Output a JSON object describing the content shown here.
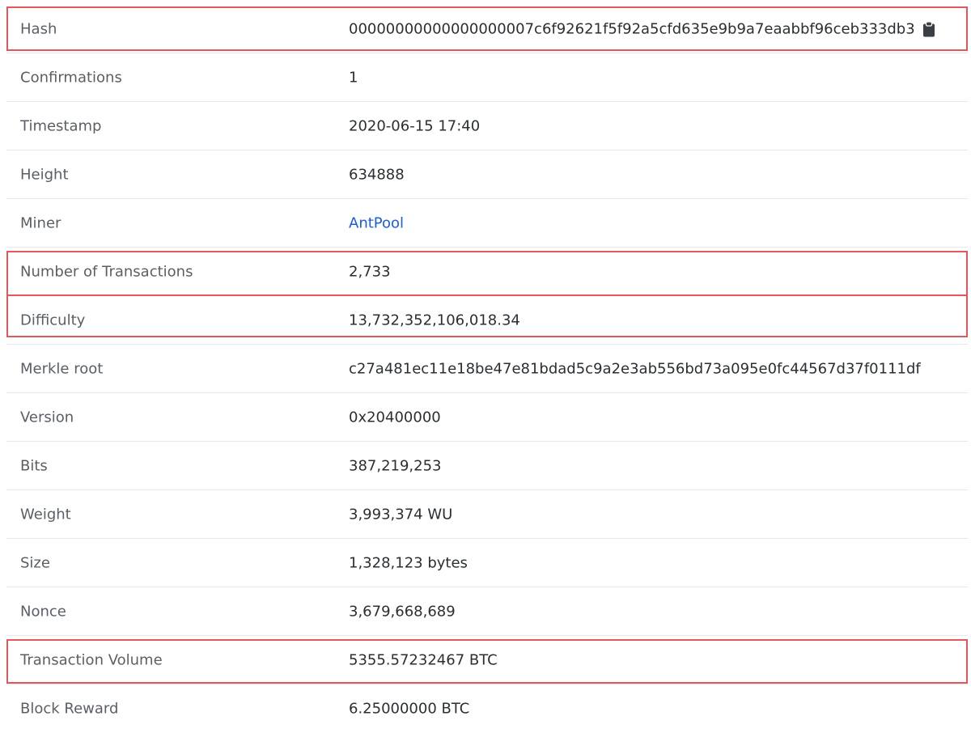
{
  "block": {
    "rows": [
      {
        "label": "Hash",
        "value": "00000000000000000007c6f92621f5f92a5cfd635e9b9a7eaabbf96ceb333db3"
      },
      {
        "label": "Confirmations",
        "value": "1"
      },
      {
        "label": "Timestamp",
        "value": "2020-06-15 17:40"
      },
      {
        "label": "Height",
        "value": "634888"
      },
      {
        "label": "Miner",
        "value": "AntPool"
      },
      {
        "label": "Number of Transactions",
        "value": "2,733"
      },
      {
        "label": "Difficulty",
        "value": "13,732,352,106,018.34"
      },
      {
        "label": "Merkle root",
        "value": "c27a481ec11e18be47e81bdad5c9a2e3ab556bd73a095e0fc44567d37f0111df"
      },
      {
        "label": "Version",
        "value": "0x20400000"
      },
      {
        "label": "Bits",
        "value": "387,219,253"
      },
      {
        "label": "Weight",
        "value": "3,993,374 WU"
      },
      {
        "label": "Size",
        "value": "1,328,123 bytes"
      },
      {
        "label": "Nonce",
        "value": "3,679,668,689"
      },
      {
        "label": "Transaction Volume",
        "value": "5355.57232467 BTC"
      },
      {
        "label": "Block Reward",
        "value": "6.25000000 BTC"
      }
    ]
  },
  "icons": {
    "copy": "clipboard-icon"
  },
  "colors": {
    "highlight": "#e0585c",
    "link": "#1a5fd6",
    "label": "#5a5f66",
    "value": "#2b2f33",
    "divider": "#e6e8eb"
  }
}
